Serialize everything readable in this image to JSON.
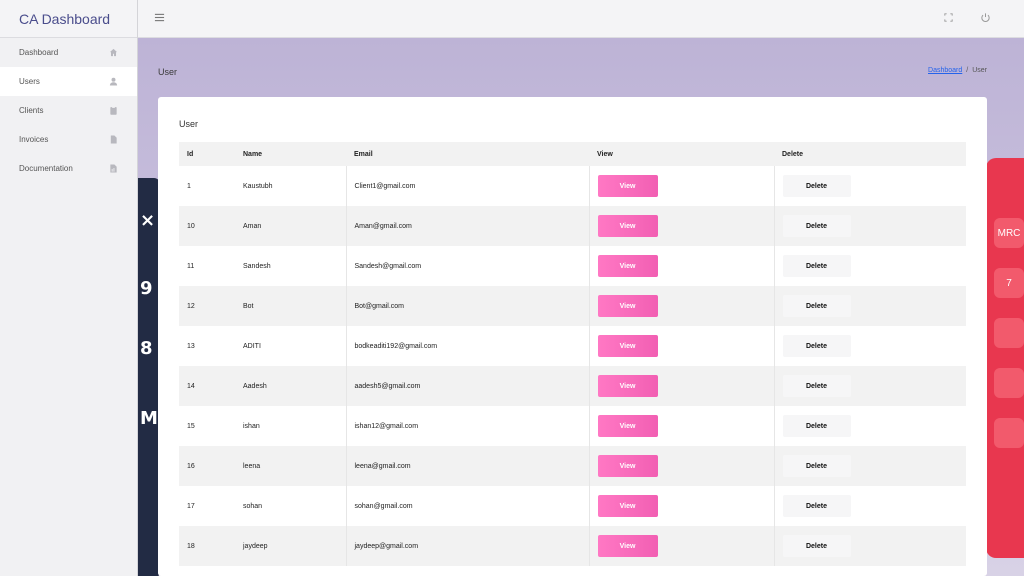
{
  "app": {
    "title": "CA Dashboard"
  },
  "sidebar": {
    "items": [
      {
        "label": "Dashboard",
        "icon": "home-icon",
        "active": false
      },
      {
        "label": "Users",
        "icon": "user-icon",
        "active": true
      },
      {
        "label": "Clients",
        "icon": "clipboard-icon",
        "active": false
      },
      {
        "label": "Invoices",
        "icon": "document-icon",
        "active": false
      },
      {
        "label": "Documentation",
        "icon": "file-chart-icon",
        "active": false
      }
    ]
  },
  "topbar": {
    "menu_icon": "hamburger-icon",
    "fullscreen_icon": "fullscreen-icon",
    "power_icon": "power-icon"
  },
  "page": {
    "title": "User",
    "breadcrumb": {
      "home": "Dashboard",
      "separator": "/",
      "current": "User"
    }
  },
  "card": {
    "title": "User",
    "columns": [
      "Id",
      "Name",
      "Email",
      "View",
      "Delete"
    ],
    "rows": [
      {
        "id": "1",
        "name": "Kaustubh",
        "email": "Client1@gmail.com"
      },
      {
        "id": "10",
        "name": "Aman",
        "email": "Aman@gmail.com"
      },
      {
        "id": "11",
        "name": "Sandesh",
        "email": "Sandesh@gmail.com"
      },
      {
        "id": "12",
        "name": "Bot",
        "email": "Bot@gmail.com"
      },
      {
        "id": "13",
        "name": "ADITI",
        "email": "bodkeaditi192@gmail.com"
      },
      {
        "id": "14",
        "name": "Aadesh",
        "email": "aadesh5@gmail.com"
      },
      {
        "id": "15",
        "name": "ishan",
        "email": "ishan12@gmail.com"
      },
      {
        "id": "16",
        "name": "leena",
        "email": "leena@gmail.com"
      },
      {
        "id": "17",
        "name": "sohan",
        "email": "sohan@gmail.com"
      },
      {
        "id": "18",
        "name": "jaydeep",
        "email": "jaydeep@gmail.com"
      }
    ],
    "view_label": "View",
    "delete_label": "Delete"
  },
  "colors": {
    "accent_pink": "#f25fb3",
    "brand_text": "#4a4d8c",
    "link": "#2563eb"
  }
}
